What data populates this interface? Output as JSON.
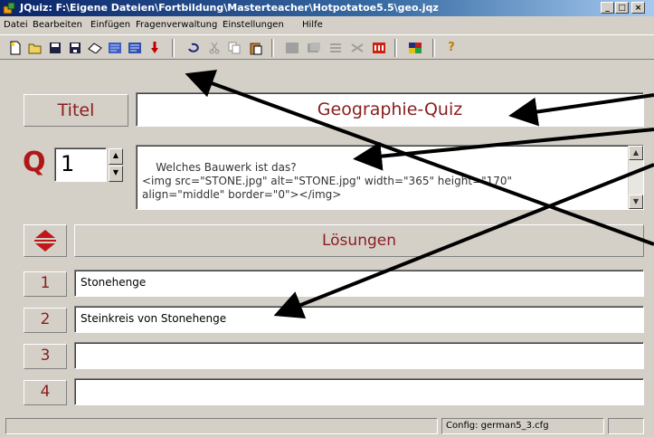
{
  "window": {
    "title": "JQuiz: F:\\Eigene Dateien\\Fortbildung\\Masterteacher\\Hotpotatoe5.5\\geo.jqz",
    "controls": [
      "_",
      "□",
      "×"
    ]
  },
  "menu": [
    "Datei",
    "Bearbeiten",
    "Einfügen",
    "Fragenverwaltung",
    "Einstellungen",
    "Hilfe"
  ],
  "toolbar": {
    "icons": [
      "new-file-icon",
      "open-folder-icon",
      "save-icon",
      "save-as-icon",
      "eraser-icon",
      "web-page-icon",
      "web-page-alt-icon",
      "hotpotatoes-icon",
      "undo-icon",
      "cut-icon",
      "copy-icon",
      "paste-icon",
      "add-question-icon",
      "delete-question-icon",
      "question-list-icon",
      "shuffle-icon",
      "red-logo-icon",
      "palette-icon",
      "help-icon"
    ],
    "help_glyph": "?"
  },
  "title_row": {
    "label": "Titel",
    "value": "Geographie-Quiz"
  },
  "question": {
    "letter": "Q",
    "number": "1",
    "text": "Welches Bauwerk ist das?\n<img src=\"STONE.jpg\" alt=\"STONE.jpg\" width=\"365\" height=\"170\"\nalign=\"middle\" border=\"0\"></img>"
  },
  "answers": {
    "header": "Lösungen",
    "rows": [
      {
        "number": "1",
        "text": "Stonehenge"
      },
      {
        "number": "2",
        "text": "Steinkreis von Stonehenge"
      },
      {
        "number": "3",
        "text": ""
      },
      {
        "number": "4",
        "text": ""
      }
    ]
  },
  "statusbar": {
    "config": "Config: german5_3.cfg"
  },
  "colors": {
    "accent": "#8b1d1d",
    "title_bar": "#0a246a",
    "panel": "#d4d0c8"
  }
}
